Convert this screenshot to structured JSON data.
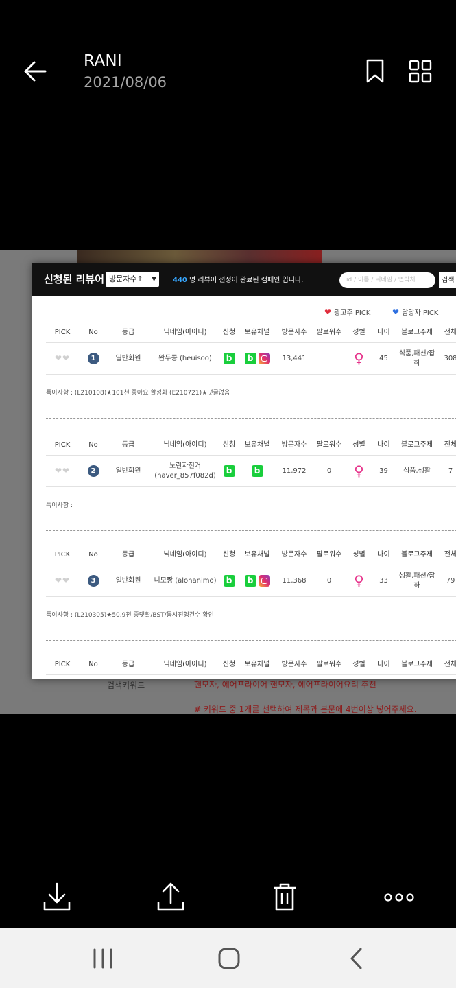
{
  "viewer": {
    "title": "RANI",
    "date": "2021/08/06",
    "actions": [
      "download-icon",
      "share-icon",
      "delete-icon",
      "more-icon"
    ]
  },
  "panel": {
    "title": "신청된 리뷰어",
    "sort_select": "방문자수↑",
    "note_count": "440",
    "note_text": " 명 리뷰어 선정이 완료된 캠페인 입니다.",
    "search_placeholder": "id / 이름 / 닉네임 / 연락처",
    "search_button": "검색",
    "legend_ad": "광고주 PICK",
    "legend_manager": "담당자 PICK"
  },
  "columns": [
    "PICK",
    "No",
    "등급",
    "닉네임(아이디)",
    "신청",
    "보유채널",
    "방문자수",
    "팔로워수",
    "성별",
    "나이",
    "블로그주제",
    "전체"
  ],
  "reviewers": [
    {
      "no": "1",
      "grade": "일반회원",
      "nickname": "완두콩 (heuisoo)",
      "visitors": "13,441",
      "followers": "",
      "age": "45",
      "topic": "식품,패션/잡하",
      "total": "308",
      "instagram": true,
      "note": "특이사항 : (L210108)★101천 좋아요 활성화 (E210721)★댓글없음"
    },
    {
      "no": "2",
      "grade": "일반회원",
      "nickname": "노란자전거 (naver_857f082d)",
      "visitors": "11,972",
      "followers": "0",
      "age": "39",
      "topic": "식품,생활",
      "total": "7",
      "instagram": false,
      "note": "특이사항 :"
    },
    {
      "no": "3",
      "grade": "일반회원",
      "nickname": "니모짱 (alohanimo)",
      "visitors": "11,368",
      "followers": "0",
      "age": "33",
      "topic": "생활,패션/잡하",
      "total": "79",
      "instagram": true,
      "note": "특이사항 : (L210305)★50.9천 좋댓활/BST/동시진행건수 확인"
    }
  ],
  "behind": {
    "keyword_label": "검색키워드",
    "keyword_text": "핸모자, 에어프라이어 핸모자, 에어프라이어요리 추천",
    "instruction": "# 키워드 중 1개를 선택하여 제목과 본문에 4번이상 넣어주세요."
  },
  "colors": {
    "accent_blue": "#37a7ff",
    "naver_green": "#19ce3c",
    "female_pink": "#e6338b",
    "badge_navy": "#3c5a80"
  }
}
